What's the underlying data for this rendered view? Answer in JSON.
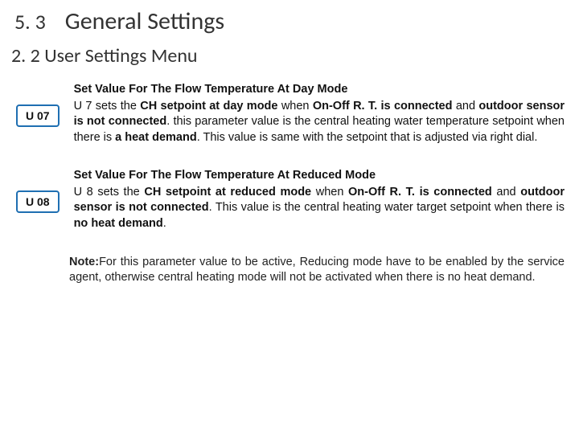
{
  "header": {
    "section_number": "5. 3",
    "section_title": "General Settings"
  },
  "subsection": "2. 2 User Settings Menu",
  "u07": {
    "badge": "U 07",
    "title": "Set Value For The Flow Temperature At Day Mode",
    "t1": "U 7 sets the ",
    "b1": "CH setpoint at day mode",
    "t2": " when ",
    "b2": "On-Off R. T. is connected",
    "t3": " and ",
    "b3": "outdoor sensor is not connected",
    "t4": ". this parameter value is the central heating water temperature setpoint when there is ",
    "b4": "a heat demand",
    "t5": ". This value is same with the setpoint that is adjusted via right dial."
  },
  "u08": {
    "badge": "U 08",
    "title": "Set Value For The Flow Temperature At Reduced Mode",
    "t1": "U 8 sets the ",
    "b1": "CH setpoint at reduced mode",
    "t2": " when ",
    "b2": "On-Off R. T. is connected",
    "t3": " and ",
    "b3": "outdoor sensor is not connected",
    "t4": ". This value is the central heating water target setpoint when there is ",
    "b4": "no heat demand",
    "t5": "."
  },
  "note": {
    "label": "Note:",
    "text": "For this parameter value to be active, Reducing mode have to be enabled by the service agent, otherwise central heating mode will not be activated when there is no heat demand."
  }
}
